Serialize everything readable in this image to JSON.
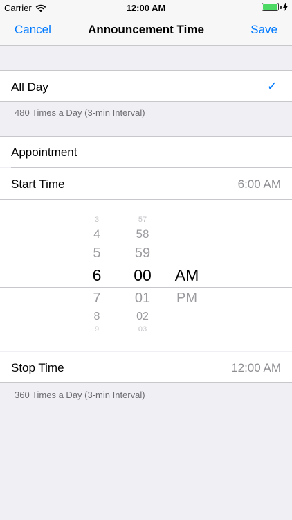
{
  "status": {
    "carrier": "Carrier",
    "time": "12:00 AM"
  },
  "nav": {
    "cancel": "Cancel",
    "title": "Announcement Time",
    "save": "Save"
  },
  "all_day": {
    "label": "All Day",
    "checkmark": "✓",
    "footer": "480 Times a Day (3-min Interval)"
  },
  "appointment": {
    "label": "Appointment",
    "start_label": "Start Time",
    "start_value": "6:00 AM",
    "stop_label": "Stop Time",
    "stop_value": "12:00 AM",
    "footer": "360 Times a Day (3-min Interval)"
  },
  "picker": {
    "hours_above": [
      "3",
      "4",
      "5"
    ],
    "hour_selected": "6",
    "hours_below": [
      "7",
      "8",
      "9"
    ],
    "minutes_above": [
      "57",
      "58",
      "59"
    ],
    "minute_selected": "00",
    "minutes_below": [
      "01",
      "02",
      "03"
    ],
    "ampm_selected": "AM",
    "ampm_below": "PM"
  },
  "colors": {
    "accent": "#007AFF",
    "secondary_text": "#8E8E93",
    "battery": "#4CD964"
  }
}
